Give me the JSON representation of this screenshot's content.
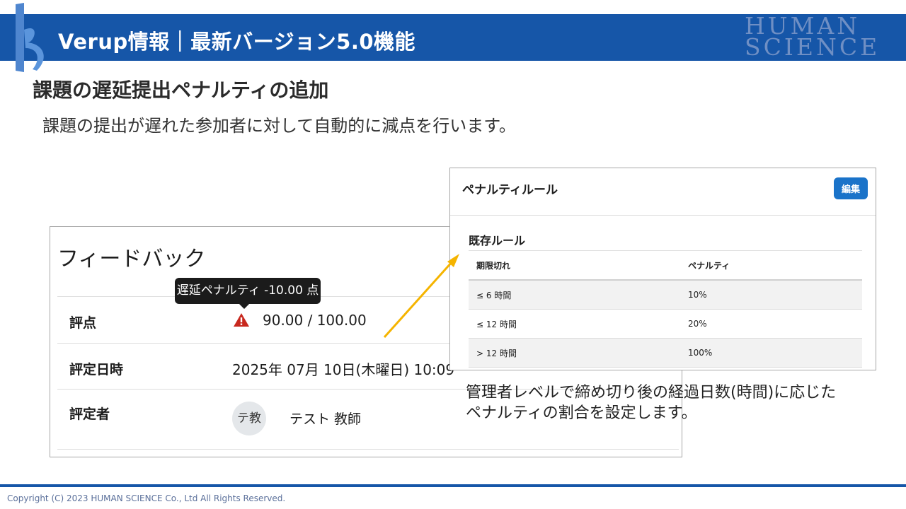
{
  "header": {
    "title": "Verup情報｜最新バージョン5.0機能",
    "brand_line1": "HUMAN",
    "brand_line2": "SCIENCE",
    "logo_icon": "human-science-logo"
  },
  "section": {
    "title": "課題の遅延提出ペナルティの追加",
    "description": "課題の提出が遅れた参加者に対して自動的に減点を行います。"
  },
  "feedback": {
    "title": "フィードバック",
    "tooltip": "遅延ペナルティ -10.00 点",
    "rows": [
      {
        "label": "評点",
        "value": "90.00 / 100.00",
        "icon": "warning-icon"
      },
      {
        "label": "評定日時",
        "value": "2025年 07月 10日(木曜日) 10:09"
      },
      {
        "label": "評定者",
        "avatar": "テ教",
        "value": "テスト 教師"
      }
    ]
  },
  "penalty": {
    "title": "ペナルティルール",
    "edit_button": "編集",
    "subtitle": "既存ルール",
    "columns": [
      "期限切れ",
      "ペナルティ"
    ],
    "rows": [
      [
        "≤ 6 時間",
        "10%"
      ],
      [
        "≤ 12 時間",
        "20%"
      ],
      [
        "> 12 時間",
        "100%"
      ]
    ]
  },
  "callout": {
    "line1": "管理者レベルで締め切り後の経過日数(時間)に応じた",
    "line2": "ペナルティの割合を設定します。"
  },
  "footer": {
    "copyright": "Copyright (C) 2023 HUMAN SCIENCE Co., Ltd All Rights Reserved."
  },
  "colors": {
    "header_blue": "#1656a8",
    "button_blue": "#1a73c9",
    "arrow_yellow": "#f5b400",
    "warning_red": "#c8281e"
  }
}
